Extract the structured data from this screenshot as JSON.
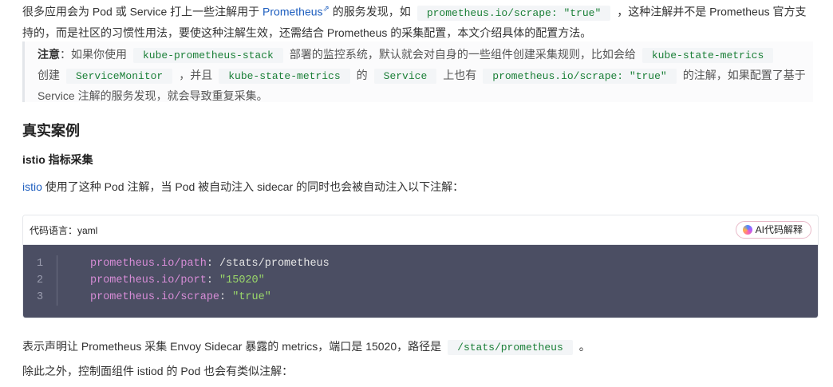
{
  "intro": {
    "t1": "很多应用会为 Pod 或 Service 打上一些注解用于 ",
    "link_prometheus": "Prometheus",
    "t2": " 的服务发现，如",
    "code_scrape": "prometheus.io/scrape: \"true\"",
    "t3": "，这种注解并不是 Prometheus 官方支持的，而是社区的习惯性用法，要使这种注解生效，还需结合 Prometheus 的采集配置，本文介绍具体的配置方法。"
  },
  "note": {
    "label": "注意",
    "t1": "：如果你使用",
    "code_stack": "kube-prometheus-stack",
    "t2": "部署的监控系统，默认就会对自身的一些组件创建采集规则，比如会给",
    "code_ksm1": "kube-state-metrics",
    "t3": "创建",
    "code_sm": "ServiceMonitor",
    "t4": "，并且",
    "code_ksm2": "kube-state-metrics",
    "t5": "的",
    "code_service": "Service",
    "t6": "上也有",
    "code_scrape": "prometheus.io/scrape: \"true\"",
    "t7": "的注解，如果配置了基于 Service 注解的服务发现，就会导致重复采集。"
  },
  "section_title": "真实案例",
  "subsection_title": "istio 指标采集",
  "istio_para": {
    "link": "istio",
    "text": " 使用了这种 Pod 注解，当 Pod 被自动注入 sidecar 的同时也会被自动注入以下注解："
  },
  "codeblock": {
    "lang_label": "代码语言：yaml",
    "ai_button": "AI代码解释",
    "lines": [
      {
        "no": "1",
        "key": "prometheus.io/path",
        "sep": ": ",
        "val": "/stats/prometheus",
        "is_string": false
      },
      {
        "no": "2",
        "key": "prometheus.io/port",
        "sep": ": ",
        "val": "\"15020\"",
        "is_string": true
      },
      {
        "no": "3",
        "key": "prometheus.io/scrape",
        "sep": ": ",
        "val": "\"true\"",
        "is_string": true
      }
    ]
  },
  "explain": {
    "t1": "表示声明让 Prometheus 采集 Envoy Sidecar 暴露的 metrics，端口是 15020，路径是",
    "code_path": "/stats/prometheus",
    "t2": "。"
  },
  "besides": "除此之外，控制面组件 istiod 的 Pod 也会有类似注解："
}
